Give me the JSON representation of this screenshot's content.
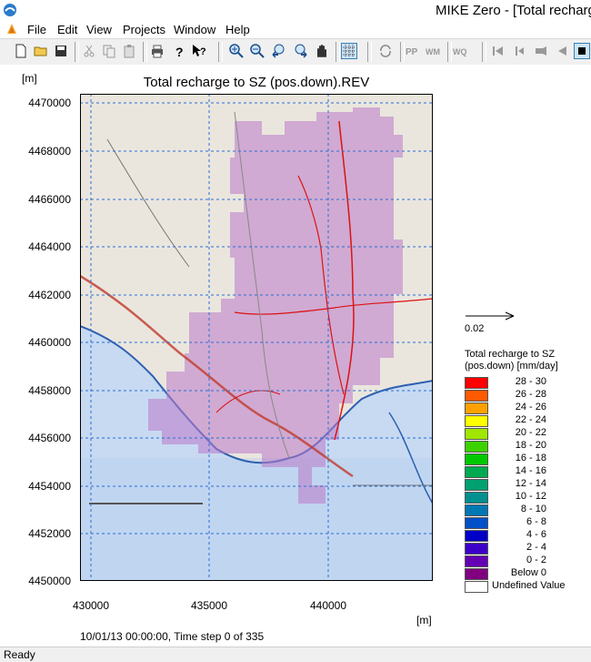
{
  "window": {
    "title": "MIKE Zero - [Total recharg"
  },
  "menu": [
    "File",
    "Edit",
    "View",
    "Projects",
    "Window",
    "Help"
  ],
  "toolbar_icons": [
    "new-file-icon",
    "open-folder-icon",
    "save-icon",
    "cut-icon",
    "copy-icon",
    "paste-icon",
    "print-icon",
    "help-icon",
    "context-help-icon",
    "zoom-in-icon",
    "zoom-out-icon",
    "zoom-previous-icon",
    "zoom-next-icon",
    "pan-icon",
    "grid-icon",
    "refresh-icon",
    "pp-icon",
    "wm-icon",
    "wq-icon",
    "first-frame-icon",
    "previous-frame-icon",
    "record-icon",
    "play-back-icon",
    "stop-icon"
  ],
  "plot": {
    "title": "Total recharge to SZ (pos.down).REV",
    "y_unit": "[m]",
    "x_unit": "[m]",
    "y_ticks": [
      "4470000",
      "4468000",
      "4466000",
      "4464000",
      "4462000",
      "4460000",
      "4458000",
      "4456000",
      "4454000",
      "4452000",
      "4450000"
    ],
    "x_ticks": [
      "430000",
      "435000",
      "440000"
    ],
    "timestep": "10/01/13 00:00:00, Time step 0 of 335"
  },
  "vector_scale": {
    "label": "0.02"
  },
  "legend": {
    "title_line1": "Total recharge to SZ",
    "title_line2": "(pos.down) [mm/day]",
    "items": [
      {
        "label": "28 - 30",
        "color": "#ff0000"
      },
      {
        "label": "26 - 28",
        "color": "#ff5a00"
      },
      {
        "label": "24 - 26",
        "color": "#ffa000"
      },
      {
        "label": "22 - 24",
        "color": "#ffff00"
      },
      {
        "label": "20 - 22",
        "color": "#a0e600"
      },
      {
        "label": "18 - 20",
        "color": "#3cd200"
      },
      {
        "label": "16 - 18",
        "color": "#00c800"
      },
      {
        "label": "14 - 16",
        "color": "#00aa50"
      },
      {
        "label": "12 - 14",
        "color": "#00a070"
      },
      {
        "label": "10 - 12",
        "color": "#009090"
      },
      {
        "label": "8 - 10",
        "color": "#0078b4"
      },
      {
        "label": "6 - 8",
        "color": "#0050c8"
      },
      {
        "label": "4 - 6",
        "color": "#0000c8"
      },
      {
        "label": "2 - 4",
        "color": "#3c00c8"
      },
      {
        "label": "0 - 2",
        "color": "#6400b4"
      },
      {
        "label": "Below    0",
        "color": "#800080"
      },
      {
        "label": "Undefined Value",
        "color": "#ffffff"
      }
    ]
  },
  "status": {
    "text": "Ready"
  }
}
